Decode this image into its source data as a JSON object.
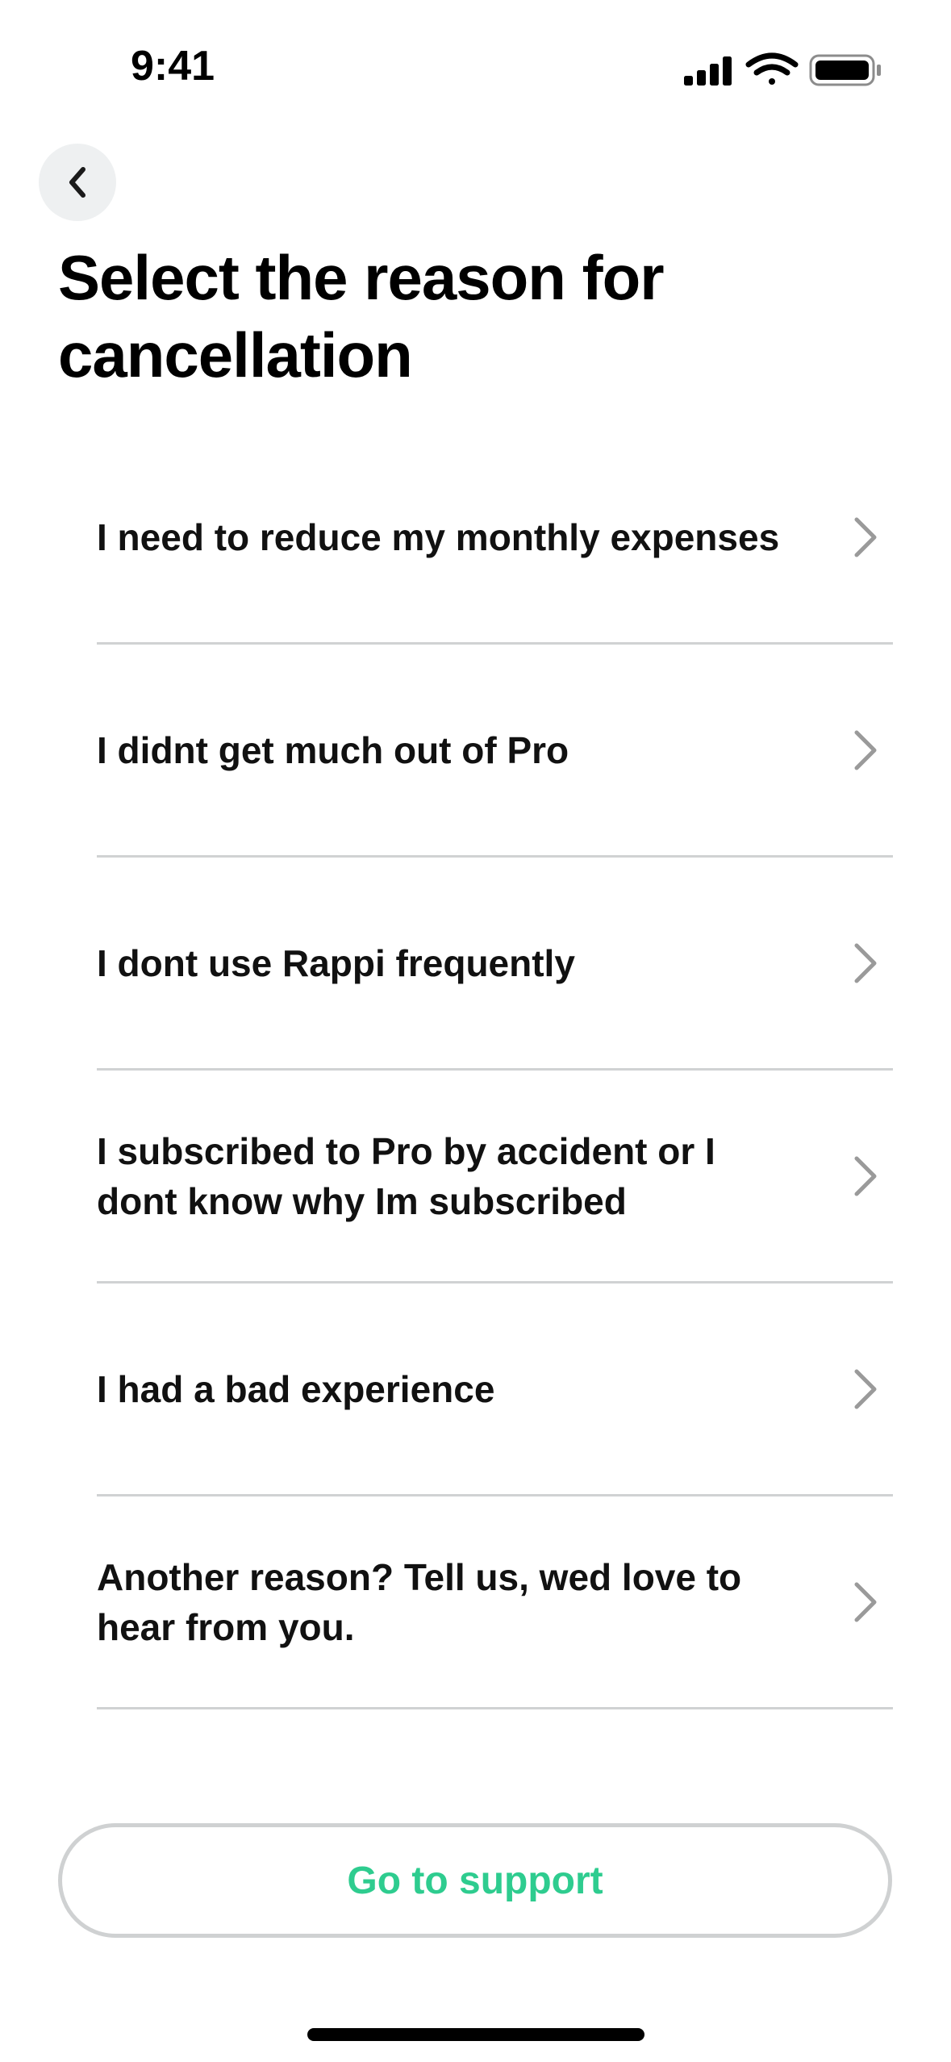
{
  "status_bar": {
    "time": "9:41",
    "icons": [
      "cellular-signal-icon",
      "wifi-icon",
      "battery-icon"
    ]
  },
  "header": {
    "back_icon": "chevron-left-icon",
    "title": "Select the reason for cancellation"
  },
  "reasons": [
    {
      "label": "I need to reduce my monthly expenses"
    },
    {
      "label": "I didnt get much out of Pro"
    },
    {
      "label": "I dont use Rappi frequently"
    },
    {
      "label": "I subscribed to Pro by accident or I dont know why Im subscribed"
    },
    {
      "label": "I had a bad experience"
    },
    {
      "label": "Another reason? Tell us, wed love to hear from you."
    }
  ],
  "support_button": {
    "label": "Go to support",
    "color": "#2ecc8f"
  },
  "colors": {
    "back_button_bg": "#eef0f1",
    "divider": "#d0d2d3",
    "chevron": "#9a9a9a"
  }
}
